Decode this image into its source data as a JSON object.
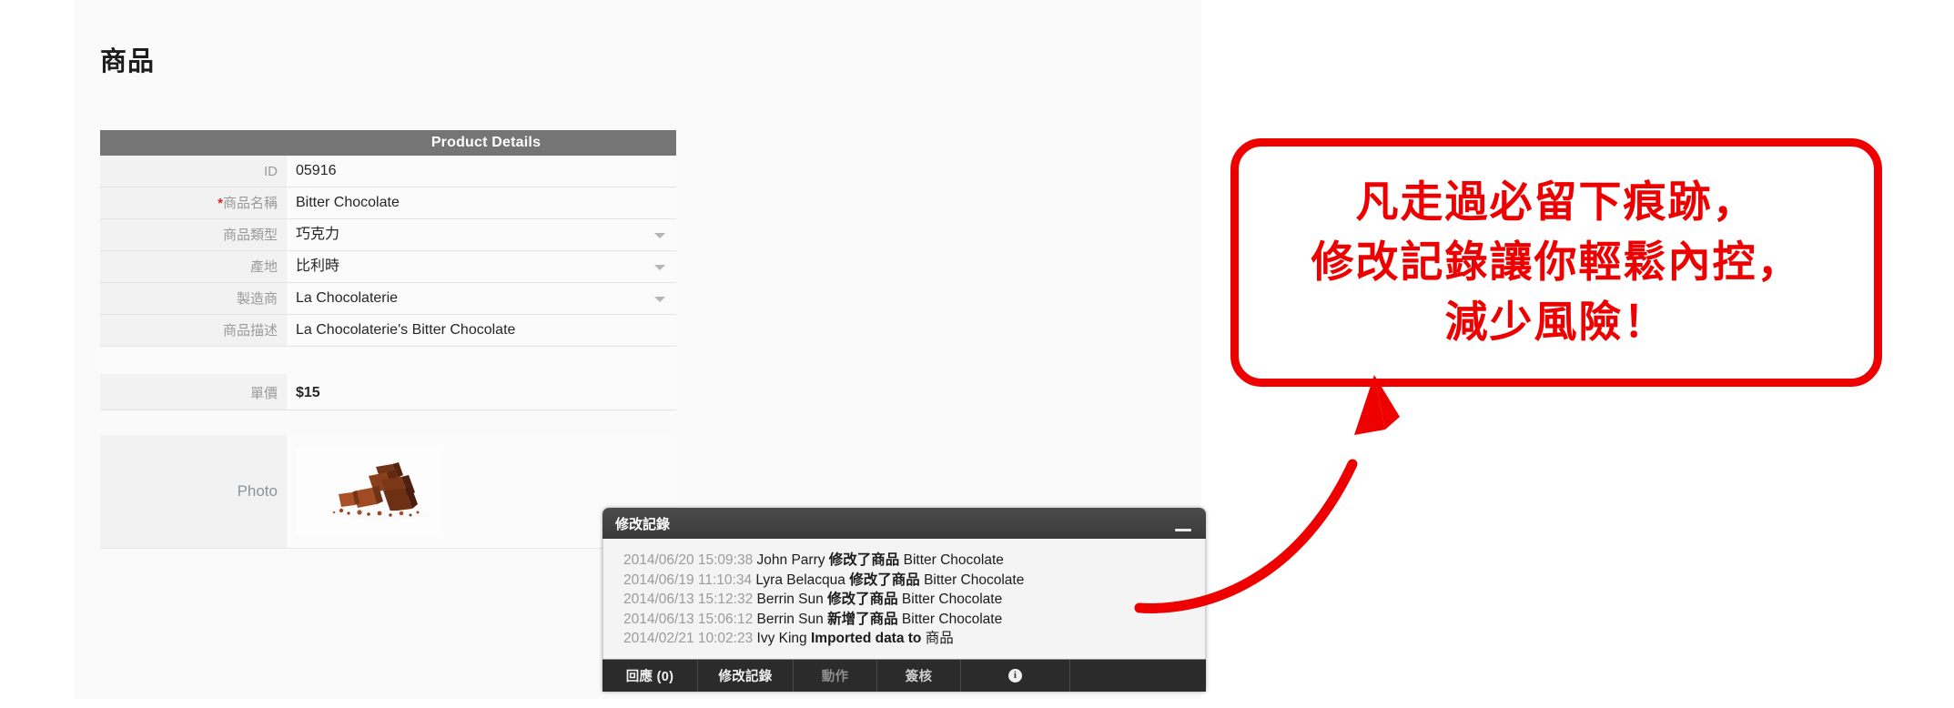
{
  "page": {
    "title": "商品"
  },
  "details": {
    "header": "Product Details",
    "rows": [
      {
        "label": "ID",
        "required": false,
        "value": "05916",
        "dropdown": false,
        "bold": false
      },
      {
        "label": "商品名稱",
        "required": true,
        "value": "Bitter Chocolate",
        "dropdown": false,
        "bold": false
      },
      {
        "label": "商品類型",
        "required": false,
        "value": "巧克力",
        "dropdown": true,
        "bold": false
      },
      {
        "label": "產地",
        "required": false,
        "value": "比利時",
        "dropdown": true,
        "bold": false
      },
      {
        "label": "製造商",
        "required": false,
        "value": "La Chocolaterie",
        "dropdown": true,
        "bold": false
      },
      {
        "label": "商品描述",
        "required": false,
        "value": "La Chocolaterie's Bitter Chocolate",
        "dropdown": false,
        "bold": false
      }
    ],
    "price_row": {
      "label": "單價",
      "value": "$15"
    },
    "photo_row": {
      "label": "Photo",
      "alt": "bitter-chocolate-photo"
    }
  },
  "history_panel": {
    "title": "修改記錄",
    "minimize_label": "—",
    "entries": [
      {
        "timestamp": "2014/06/20 15:09:38",
        "user": "John Parry",
        "action": "修改了商品",
        "object": "Bitter Chocolate"
      },
      {
        "timestamp": "2014/06/19 11:10:34",
        "user": "Lyra Belacqua",
        "action": "修改了商品",
        "object": "Bitter Chocolate"
      },
      {
        "timestamp": "2014/06/13 15:12:32",
        "user": "Berrin Sun",
        "action": "修改了商品",
        "object": "Bitter Chocolate"
      },
      {
        "timestamp": "2014/06/13 15:06:12",
        "user": "Berrin Sun",
        "action": "新增了商品",
        "object": "Bitter Chocolate"
      },
      {
        "timestamp": "2014/02/21 10:02:23",
        "user": "Ivy King",
        "action": "Imported data to",
        "object": "商品"
      }
    ],
    "tabs": [
      {
        "label": "回應 (0)",
        "active": false
      },
      {
        "label": "修改記錄",
        "active": true
      },
      {
        "label": "動作",
        "active": false
      },
      {
        "label": "簽核",
        "active": false
      },
      {
        "label": "",
        "icon": "info-icon",
        "active": false
      }
    ]
  },
  "annotation": {
    "lines": [
      "凡走過必留下痕跡，",
      "修改記錄讓你輕鬆內控，",
      "減少風險！"
    ],
    "color": "#ef0000",
    "arrow": "curved-arrow-pointing-up-right"
  }
}
